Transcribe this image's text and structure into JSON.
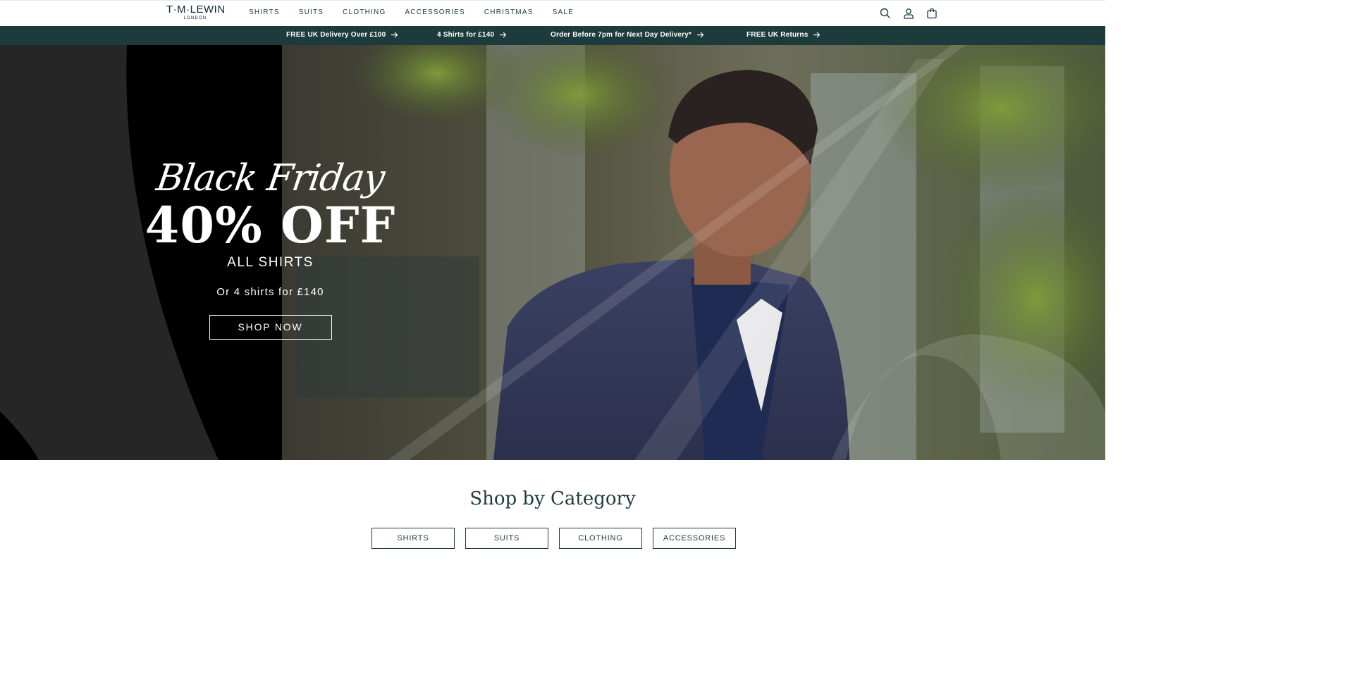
{
  "header": {
    "logo_main": "T·M·LEWIN",
    "logo_sub": "LONDON",
    "nav": [
      "SHIRTS",
      "SUITS",
      "CLOTHING",
      "ACCESSORIES",
      "CHRISTMAS",
      "SALE"
    ],
    "icons": [
      "search-icon",
      "account-icon",
      "cart-icon"
    ]
  },
  "promo_bar": {
    "items": [
      "FREE UK Delivery Over £100",
      "4 Shirts for £140",
      "Order Before 7pm for Next Day Delivery*",
      "FREE UK Returns"
    ]
  },
  "hero": {
    "script_title": "Black Friday",
    "headline": "40% OFF",
    "subheadline": "ALL SHIRTS",
    "offer": "Or 4 shirts for £140",
    "cta": "SHOP NOW"
  },
  "categories": {
    "title": "Shop by Category",
    "buttons": [
      "SHIRTS",
      "SUITS",
      "CLOTHING",
      "ACCESSORIES"
    ]
  },
  "colors": {
    "promo_bg": "#1d3a3c",
    "text_dark": "#1e3a3f",
    "hero_black": "#000000"
  }
}
